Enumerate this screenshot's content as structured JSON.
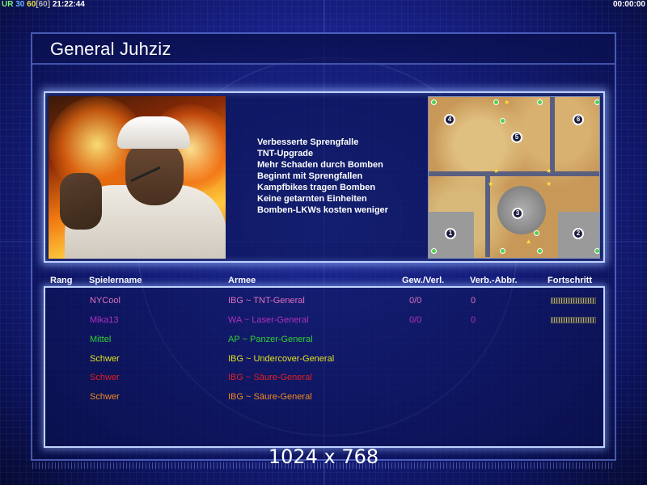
{
  "hud": {
    "fps_label": "UR",
    "fps_value": "30",
    "fps_cap": "60",
    "fps_cap_bracket": "[60]",
    "clock": "21:22:44",
    "elapsed": "00:00:00"
  },
  "general": {
    "title": "General Juhziz",
    "bonuses": [
      "Verbesserte Sprengfalle",
      "TNT-Upgrade",
      "Mehr Schaden durch Bomben",
      "Beginnt mit Sprengfallen",
      "Kampfbikes tragen Bomben",
      "Keine getarnten Einheiten",
      "Bomben-LKWs kosten weniger"
    ]
  },
  "minimap": {
    "slots": [
      "1",
      "2",
      "3",
      "4",
      "5",
      "6"
    ]
  },
  "table": {
    "headers": {
      "rank": "Rang",
      "player": "Spielername",
      "army": "Armee",
      "wl": "Gew./Verl.",
      "dq": "Verb.-Abbr.",
      "progress": "Fortschritt"
    },
    "rows": [
      {
        "name": "NYCool",
        "army": "IBG ~ TNT-General",
        "wl": "0/0",
        "dq": "0",
        "progress": true,
        "color": "#e070c0"
      },
      {
        "name": "Mika13",
        "army": "WA ~ Laser-General",
        "wl": "0/0",
        "dq": "0",
        "progress": true,
        "color": "#b030c0"
      },
      {
        "name": "Mittel",
        "army": "AP ~ Panzer-General",
        "wl": "",
        "dq": "",
        "progress": false,
        "color": "#30d030"
      },
      {
        "name": "Schwer",
        "army": "IBG ~ Undercover-General",
        "wl": "",
        "dq": "",
        "progress": false,
        "color": "#e0e020"
      },
      {
        "name": "Schwer",
        "army": "IBG ~ Säure-General",
        "wl": "",
        "dq": "",
        "progress": false,
        "color": "#e02020"
      },
      {
        "name": "Schwer",
        "army": "IBG ~ Säure-General",
        "wl": "",
        "dq": "",
        "progress": false,
        "color": "#f08a20"
      }
    ]
  },
  "resolution": "1024 x 768"
}
